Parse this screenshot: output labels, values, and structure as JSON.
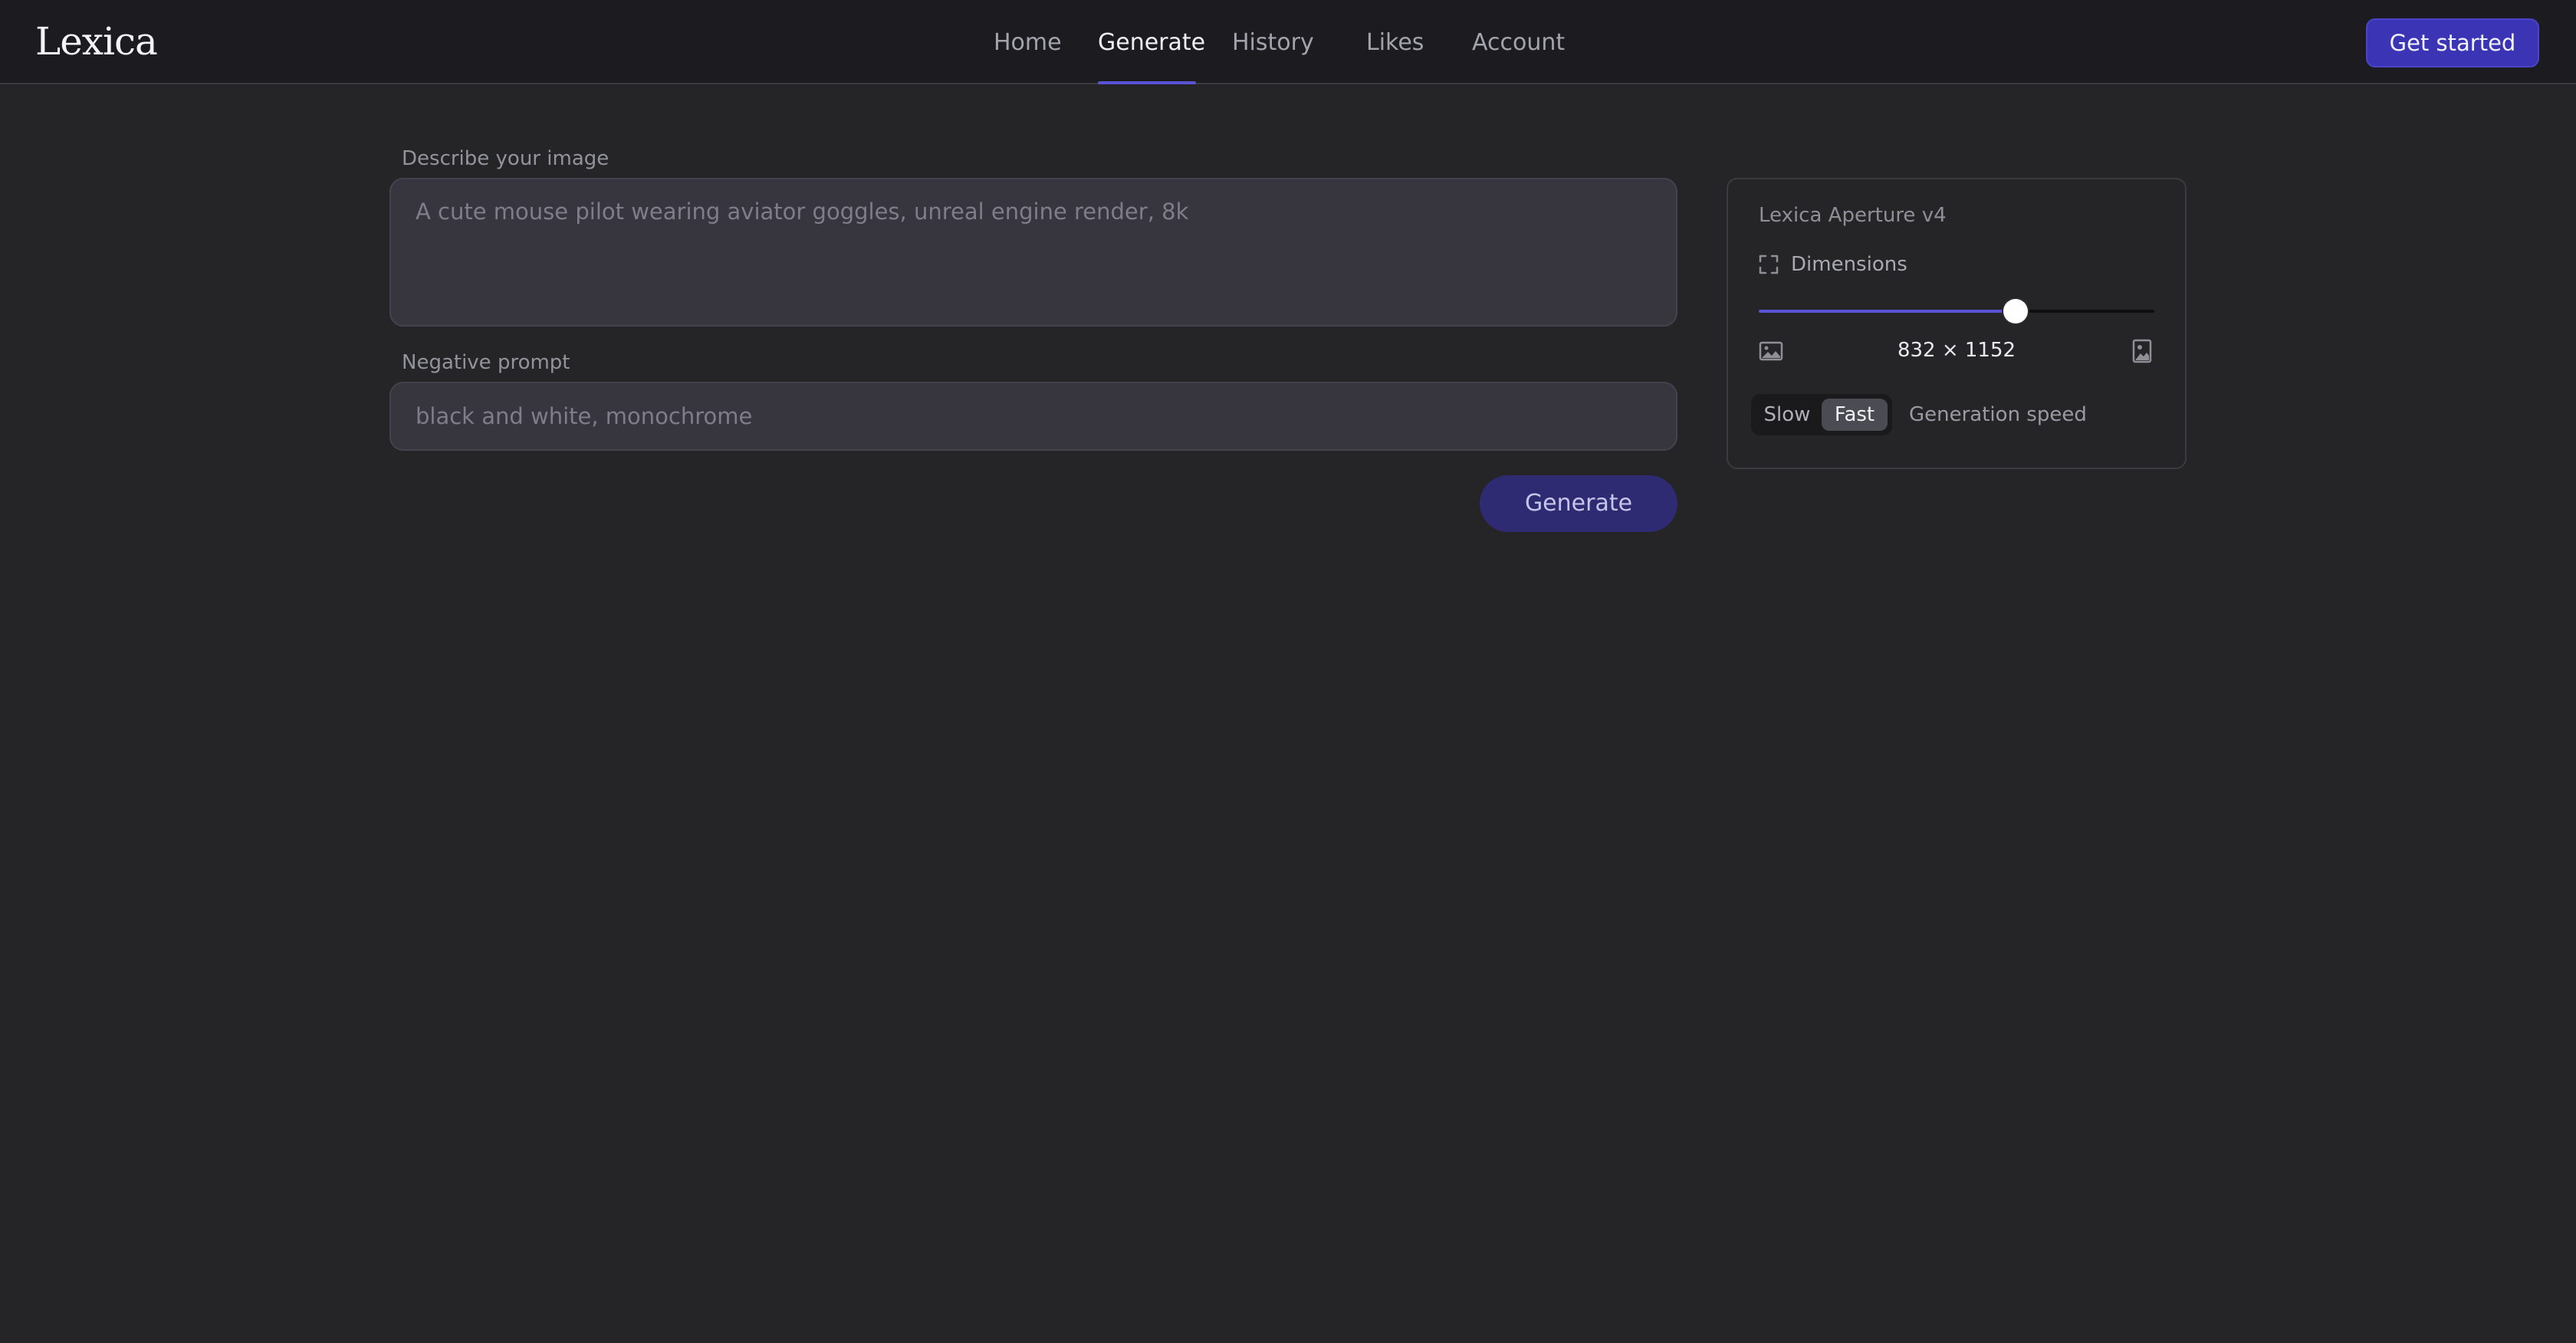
{
  "app": {
    "logo": "Lexica"
  },
  "nav": {
    "items": [
      {
        "label": "Home"
      },
      {
        "label": "Generate"
      },
      {
        "label": "History"
      },
      {
        "label": "Likes"
      },
      {
        "label": "Account"
      }
    ],
    "active": "Generate",
    "cta_label": "Get started"
  },
  "form": {
    "prompt_label": "Describe your image",
    "prompt_placeholder": "A cute mouse pilot wearing aviator goggles, unreal engine render, 8k",
    "negative_label": "Negative prompt",
    "negative_placeholder": "black and white, monochrome",
    "generate_label": "Generate"
  },
  "settings": {
    "model": "Lexica Aperture v4",
    "dimensions_label": "Dimensions",
    "aspect_slider_fraction": 0.65,
    "dimensions_value": "832 × 1152",
    "speed_options": [
      "Slow",
      "Fast"
    ],
    "speed_selected": "Fast",
    "speed_label": "Generation speed"
  },
  "colors": {
    "background": "#252528",
    "topbar": "#1c1c20",
    "accent": "#5b53d6",
    "cta": "#3b35b6",
    "generate_button": "#2f2b73"
  },
  "icons": {
    "dimensions": "expand-corners-icon",
    "landscape": "landscape-image-icon",
    "portrait": "portrait-image-icon"
  }
}
